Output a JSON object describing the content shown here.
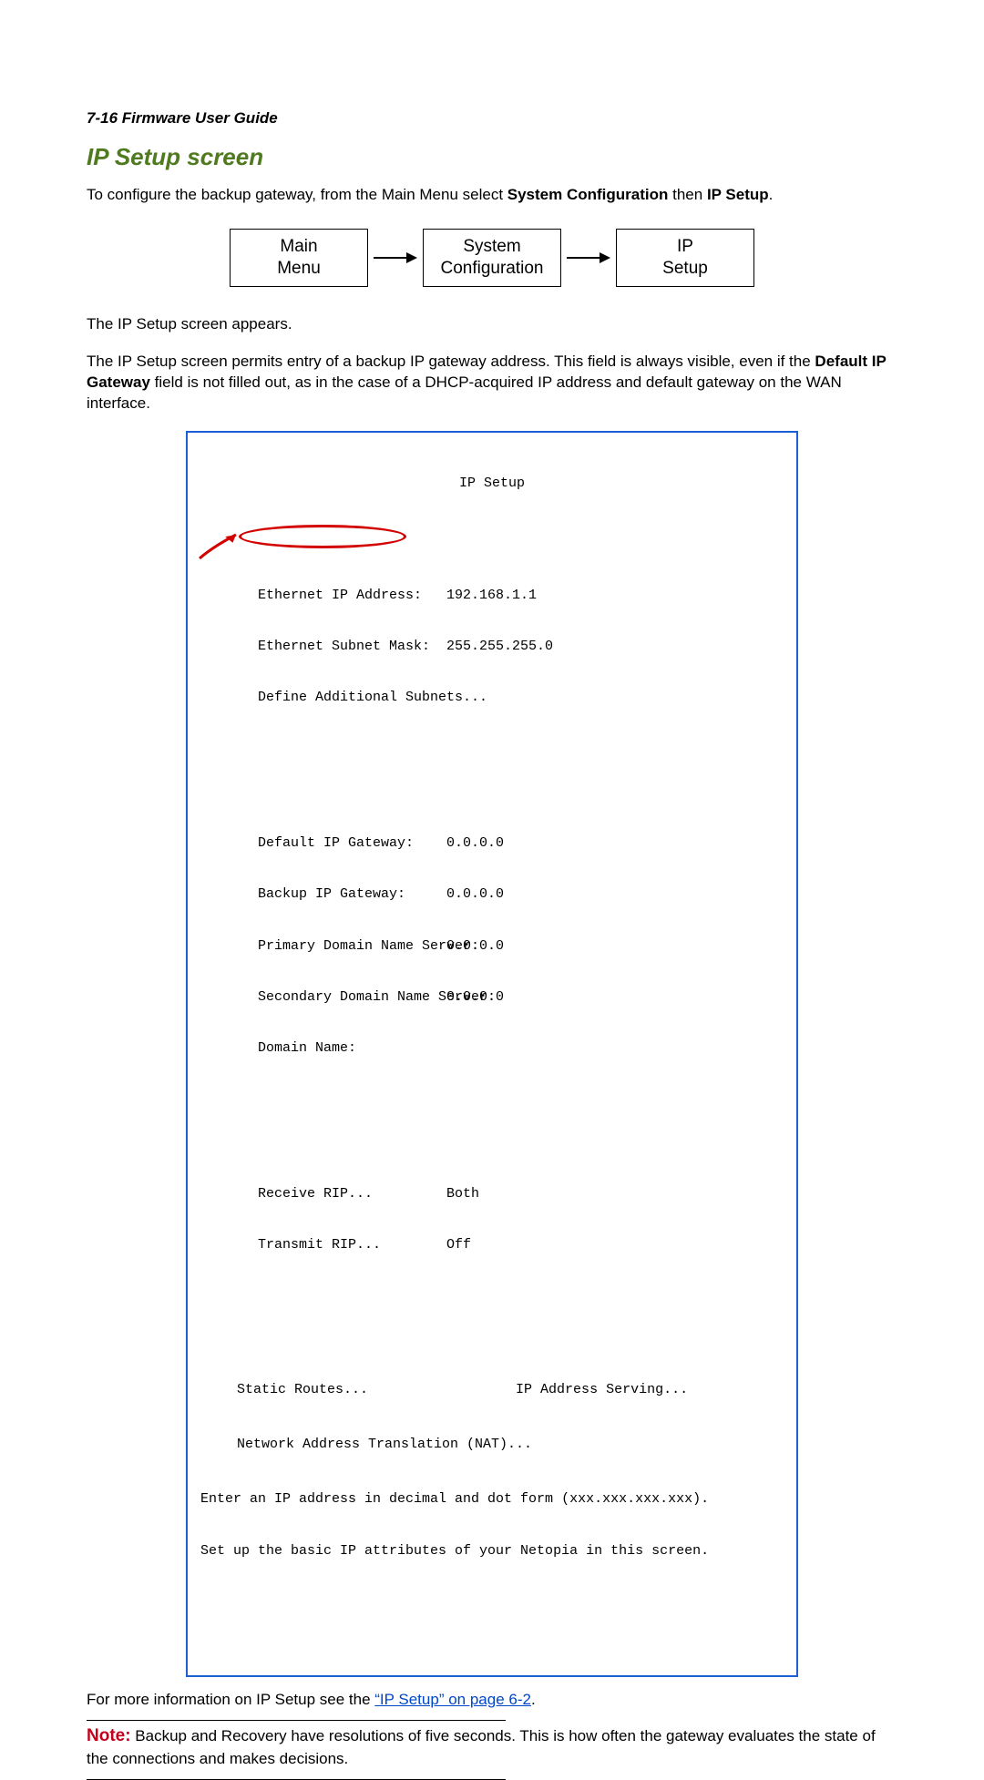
{
  "header": {
    "page_ref": "7-16  Firmware User Guide"
  },
  "section_title": "IP Setup screen",
  "intro": {
    "pre": "To configure the backup gateway, from the Main Menu select ",
    "bold1": "System Configuration",
    "mid": " then ",
    "bold2": "IP Setup",
    "post": "."
  },
  "flow": {
    "box1": "Main\nMenu",
    "box2": "System\nConfiguration",
    "box3": "IP\nSetup"
  },
  "para_appears": "The IP Setup screen appears.",
  "para_permits": {
    "pre": "The IP Setup screen permits entry of a backup IP gateway address. This field is always visible, even if the ",
    "bold": "Default IP Gateway",
    "post": " field is not filled out, as in the case of a DHCP-acquired IP address and default gateway on the WAN interface."
  },
  "terminal": {
    "title": "IP Setup",
    "rows1": [
      {
        "label": "Ethernet IP Address:",
        "value": "192.168.1.1"
      },
      {
        "label": "Ethernet Subnet Mask:",
        "value": "255.255.255.0"
      },
      {
        "label": "Define Additional Subnets...",
        "value": ""
      }
    ],
    "rows2": [
      {
        "label": "Default IP Gateway:",
        "value": "0.0.0.0"
      },
      {
        "label": "Backup IP Gateway:",
        "value": "0.0.0.0"
      },
      {
        "label": "Primary Domain Name Server:",
        "value": "0.0.0.0"
      },
      {
        "label": "Secondary Domain Name Server:",
        "value": "0.0.0.0"
      },
      {
        "label": "Domain Name:",
        "value": ""
      }
    ],
    "rows3": [
      {
        "label": "Receive RIP...",
        "value": "Both"
      },
      {
        "label": "Transmit RIP...",
        "value": "Off"
      }
    ],
    "static_line": "Static Routes...                  IP Address Serving...",
    "nat_line": "Network Address Translation (NAT)...",
    "foot1": "Enter an IP address in decimal and dot form (xxx.xxx.xxx.xxx).",
    "foot2": "Set up the basic IP attributes of your Netopia in this screen."
  },
  "moreinfo": {
    "pre": "For more information on IP Setup see the ",
    "link": "“IP Setup” on page 6-2",
    "post": "."
  },
  "note": {
    "label": "Note:",
    "body": "  Backup and Recovery have resolutions of five seconds. This is how often the gateway evaluates the state of the connections and makes decisions."
  }
}
